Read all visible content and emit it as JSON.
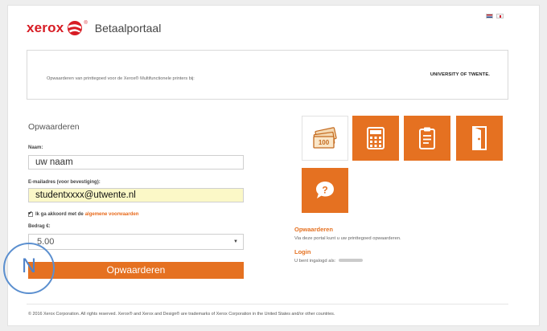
{
  "header": {
    "logo_text": "xerox",
    "logo_tm": "®",
    "portal_title": "Betaalportaal"
  },
  "banner": {
    "text": "Opwaarderen van printtegoed voor de Xerox® Multifunctionele printers bij:",
    "university": "UNIVERSITY OF TWENTE."
  },
  "form": {
    "title": "Opwaarderen",
    "name_label": "Naam:",
    "name_value": "uw naam",
    "email_label": "E-mailadres (voor bevestiging):",
    "email_value": "studentxxxx@utwente.nl",
    "agree_text": "Ik ga akkoord met de",
    "terms_link": "algemene voorwaarden",
    "amount_label": "Bedrag €:",
    "amount_value": "5.00",
    "submit_label": "Opwaarderen",
    "overlay_letter": "N"
  },
  "info": {
    "topup_title": "Opwaarderen",
    "topup_text": "Via deze portal kunt u uw printtegoed opwaarderen.",
    "login_title": "Login",
    "login_text": "U bent ingalogd als:"
  },
  "tiles": [
    {
      "icon": "money-icon"
    },
    {
      "icon": "calculator-icon"
    },
    {
      "icon": "clipboard-icon"
    },
    {
      "icon": "door-exit-icon"
    },
    {
      "icon": "help-icon"
    }
  ],
  "footer": {
    "text": "© 2016 Xerox Corporation. All rights reserved. Xerox® and Xerox and Design® are trademarks of Xerox Corporation in the United States and/or other countries."
  },
  "colors": {
    "accent": "#e57121",
    "brand_red": "#d71c24",
    "highlight": "#fbf8c7",
    "ring": "#5b8fcf"
  }
}
